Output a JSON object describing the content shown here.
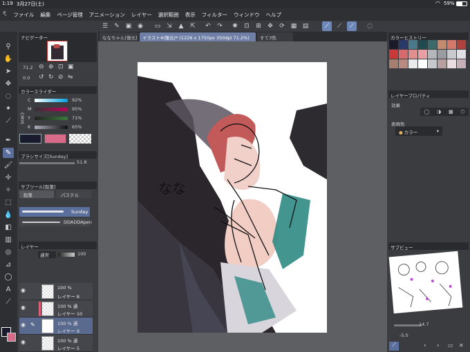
{
  "status": {
    "time": "1:19",
    "date": "3月27日(土)",
    "battery": "59%"
  },
  "menu": [
    "ファイル",
    "編集",
    "ページ管理",
    "アニメーション",
    "レイヤー",
    "選択範囲",
    "表示",
    "フィルター",
    "ウィンドウ",
    "ヘルプ"
  ],
  "tabs": [
    "ななちゃん[復元]",
    "イラスト4(復元)* (1226 x 1750px 350dpi 71.2%)",
    "すて3色"
  ],
  "navigator": {
    "title": "ナビゲーター",
    "zoom": "71.2",
    "rotate": "0.0"
  },
  "color_slider": {
    "title": "カラースライダー",
    "mode": "CMYK",
    "channels": [
      {
        "label": "C",
        "value": "92%"
      },
      {
        "label": "M",
        "value": "95%"
      },
      {
        "label": "Y",
        "value": "71%"
      },
      {
        "label": "K",
        "value": "65%"
      }
    ]
  },
  "brush_size": {
    "title": "ブラシサイズ[Sunday]",
    "value": "51.8"
  },
  "subtool": {
    "title": "サブツール[鉛筆]",
    "tabs": [
      "鉛筆",
      "パステル"
    ],
    "brushes": [
      "Sunday",
      "DDADDApen"
    ]
  },
  "layers": {
    "title": "レイヤー",
    "blend": "通常",
    "opacity": "100",
    "rows": [
      {
        "pct": "100 %",
        "name": "レイヤー 8"
      },
      {
        "pct": "100 % 通",
        "name": "レイヤー 10"
      },
      {
        "pct": "100 % 通",
        "name": "レイヤー 9"
      },
      {
        "pct": "100 % 通",
        "name": "レイヤー 5"
      }
    ]
  },
  "color_history": {
    "title": "カラーヒストリー",
    "colors": [
      "#1b1b2c",
      "#2a3a68",
      "#4a7a8a",
      "#1f4a50",
      "#3a6a6a",
      "#c28a6e",
      "#d3786a",
      "#b0413c",
      "#c83a3a",
      "#d66b6e",
      "#e08e8e",
      "#e8a0a4",
      "#b4b6bc",
      "#9a9ca2",
      "#c8cad0",
      "#e0e1e4",
      "#a58070",
      "#b88a82",
      "#eaeaec",
      "#ffffff",
      "#c7c8cc",
      "#b8a0a0",
      "#eadde0",
      "#c8b0b8"
    ]
  },
  "layer_property": {
    "title": "レイヤープロパティ",
    "effect": "効果",
    "expression": "表現色",
    "color_mode": "カラー"
  },
  "subview": {
    "title": "サブビュー",
    "zoom": "14.7",
    "angle": "-5.0"
  },
  "colors": {
    "accent": "#6d87b8",
    "main_color": "#1a1a2e",
    "sub_color": "#d96b8a"
  }
}
